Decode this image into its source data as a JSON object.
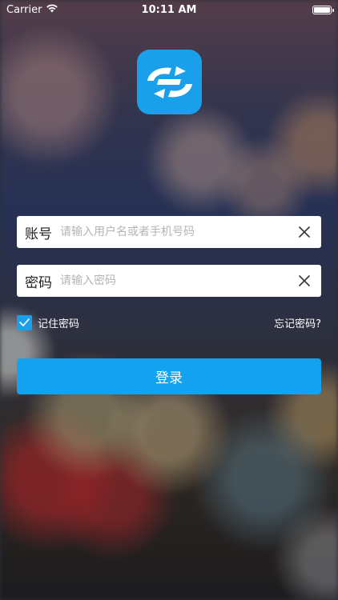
{
  "status_bar": {
    "carrier": "Carrier",
    "time": "10:11 AM"
  },
  "logo": {
    "icon": "app-logo-icon",
    "color": "#1aa0ea"
  },
  "login_form": {
    "account": {
      "label": "账号",
      "value": "",
      "placeholder": "请输入用户名或者手机号码"
    },
    "password": {
      "label": "密码",
      "value": "",
      "placeholder": "请输入密码"
    },
    "remember_password": {
      "label": "记住密码",
      "checked": true
    },
    "forgot_password_label": "忘记密码?",
    "submit_label": "登录"
  },
  "colors": {
    "accent": "#12a2ef"
  }
}
